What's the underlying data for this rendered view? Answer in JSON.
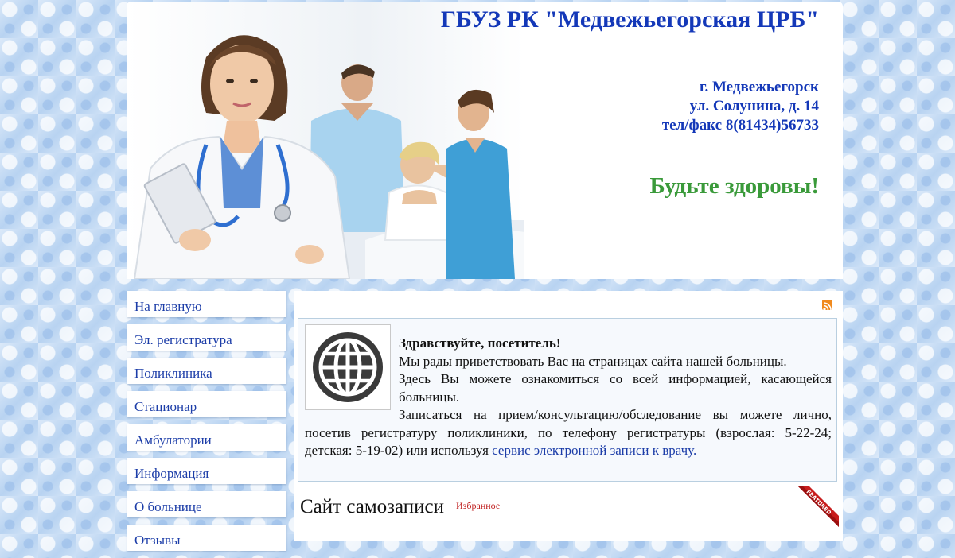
{
  "header": {
    "title": "ГБУЗ РК \"Медвежьегорская ЦРБ\"",
    "address": {
      "city": "г. Медвежьегорск",
      "street": "ул. Солунина, д. 14",
      "phone": "тел/факс 8(81434)56733"
    },
    "slogan": "Будьте здоровы!"
  },
  "sidebar": {
    "items": [
      {
        "label": "На главную"
      },
      {
        "label": "Эл. регистратура"
      },
      {
        "label": "Поликлиника"
      },
      {
        "label": "Стационар"
      },
      {
        "label": "Амбулатории"
      },
      {
        "label": "Информация"
      },
      {
        "label": "О больнице"
      },
      {
        "label": "Отзывы"
      }
    ]
  },
  "welcome": {
    "heading": "Здравствуйте, посетитель!",
    "line1": "Мы рады приветствовать Вас на страницах сайта нашей больницы.",
    "line2": "Здесь Вы можете ознакомиться со всей информацией, касающейся больницы.",
    "line3_text": "Записаться на прием/консультацию/обследование вы можете лично, посетив регистратуру поликлиники, по телефону регистратуры (взрослая: 5-22-24; детская: 5-19-02) или используя ",
    "line3_link": "сервис электронной записи к врачу."
  },
  "article": {
    "title": "Сайт самозаписи",
    "featured_label": "Избранное",
    "ribbon_text": "FEATURED"
  },
  "icons": {
    "rss": "rss-icon",
    "globe": "globe-icon",
    "ribbon": "featured-ribbon-icon"
  },
  "colors": {
    "title_blue": "#1438b8",
    "slogan_green": "#3a9a3a",
    "link_blue": "#1c3da8",
    "featured_red": "#c02020",
    "rss_orange": "#f08a1e"
  }
}
